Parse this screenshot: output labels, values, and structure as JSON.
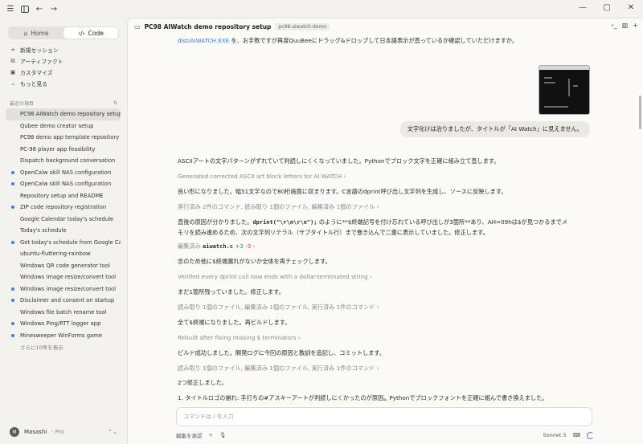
{
  "titlebar": {
    "menu_icon": "hamburger-icon",
    "sidebar_icon": "sidebar-toggle-icon",
    "back_icon": "arrow-left-icon",
    "forward_icon": "arrow-right-icon"
  },
  "sidebar": {
    "tabs": [
      {
        "label": "Home",
        "icon": "home-icon",
        "active": false
      },
      {
        "label": "Code",
        "icon": "code-icon",
        "active": true
      }
    ],
    "nav": [
      {
        "label": "新規セッション",
        "icon": "plus-icon"
      },
      {
        "label": "アーティファクト",
        "icon": "artifact-icon"
      },
      {
        "label": "カスタマイズ",
        "icon": "customize-icon"
      },
      {
        "label": "もっと見る",
        "icon": "chevron-down-icon"
      }
    ],
    "recent_heading": "最近の項目",
    "recent": [
      {
        "label": "PC98 AIWatch demo repository setup",
        "active": true,
        "dot": false
      },
      {
        "label": "Qubee demo creator setup",
        "active": false,
        "dot": false
      },
      {
        "label": "PC98 demo app template repository",
        "active": false,
        "dot": false
      },
      {
        "label": "PC-98 player app feasibility",
        "active": false,
        "dot": false
      },
      {
        "label": "Dispatch background conversation",
        "active": false,
        "dot": false
      },
      {
        "label": "OpenCalw skill NAS configuration",
        "active": false,
        "dot": true
      },
      {
        "label": "OpenCalw skill NAS configuration",
        "active": false,
        "dot": true
      },
      {
        "label": "Repository setup and README",
        "active": false,
        "dot": false
      },
      {
        "label": "ZIP code repository registration",
        "active": false,
        "dot": true
      },
      {
        "label": "Google Calendar today's schedule",
        "active": false,
        "dot": false
      },
      {
        "label": "Today's schedule",
        "active": false,
        "dot": false
      },
      {
        "label": "Get today's schedule from Google Ca",
        "active": false,
        "dot": true
      },
      {
        "label": "ubuntu-fluttering-rainbow",
        "active": false,
        "dot": false
      },
      {
        "label": "Windows QR code generator tool",
        "active": false,
        "dot": false
      },
      {
        "label": "Windows image resize/convert tool",
        "active": false,
        "dot": false
      },
      {
        "label": "Windows image resize/convert tool",
        "active": false,
        "dot": true
      },
      {
        "label": "Disclaimer and consent on startup",
        "active": false,
        "dot": true
      },
      {
        "label": "Windows file batch rename tool",
        "active": false,
        "dot": false
      },
      {
        "label": "Windows Ping/RTT logger app",
        "active": false,
        "dot": true
      },
      {
        "label": "Minesweeper WinForms game",
        "active": false,
        "dot": true
      }
    ],
    "more_label": "さらに10件を表示",
    "user": {
      "initial": "M",
      "name": "Masashi",
      "plan": "· Pro"
    }
  },
  "main": {
    "title": "PC98 AIWatch demo repository setup",
    "branch": "pc98-aiwatch-demo",
    "top_line_link": "dist/AIWATCH.EXE",
    "top_line_text": " を、お手数ですが再度QuuBeeにドラッグ&ドロップして日本語表示が直っているか確認していただけますか。",
    "user_bubble": "文字化けは治りましたが、タイトルが「AI Watch」に見えません。",
    "messages": [
      {
        "type": "text",
        "text": "ASCIIアートの文字パターンがずれていて判読しにくくなっていました。Pythonでブロック文字を正確に組み立て直します。"
      },
      {
        "type": "tool",
        "text": "Generated corrected ASCII art block letters for AI WATCH"
      },
      {
        "type": "text",
        "text": "良い形になりました。幅51文字なので80桁画面に収まります。C言語のdprint呼び出し文字列を生成し、ソースに反映します。"
      },
      {
        "type": "tool",
        "text": "実行済み 2件のコマンド, 読み取り 1個のファイル, 編集済み 1個のファイル"
      },
      {
        "type": "text2a",
        "text": "直後の原因が分かりました。",
        "code": "dprint(\"\\r\\n\\r\\n\");",
        "rest": " のように**$終端記号を付け忘れている呼び出しが3箇所**あり、AH=09hは$が見つかるまでメ"
      },
      {
        "type": "text2b",
        "text": "モリを読み進めるため、次の文字列リテラル（サブタイトル行）まで巻き込んで二重に表示していました。修正します。"
      },
      {
        "type": "edit",
        "text": "編集済み ",
        "file": "aiwatch.c",
        "add": "+3",
        "del": "-3"
      },
      {
        "type": "text",
        "text": "念のため他に$終端漏れがないか全体を再チェックします。"
      },
      {
        "type": "tool",
        "text": "Verified every dprint call now ends with a dollar-terminated string"
      },
      {
        "type": "text",
        "text": "まだ1箇所残っていました。修正します。"
      },
      {
        "type": "tool",
        "text": "読み取り 1個のファイル, 編集済み 1個のファイル, 実行済み 1件のコマンド"
      },
      {
        "type": "text",
        "text": "全て$終端になりました。再ビルドします。"
      },
      {
        "type": "tool",
        "text": "Rebuilt after fixing missing $ terminators"
      },
      {
        "type": "text",
        "text": "ビルド成功しました。開発ログに今回の原因と教訓を追記し、コミットします。"
      },
      {
        "type": "tool",
        "text": "読み取り 1個のファイル, 編集済み 1個のファイル, 実行済み 1件のコマンド"
      },
      {
        "type": "text",
        "text": "2つ修正しました。"
      },
      {
        "type": "text",
        "text": "1. タイトルロゴの崩れ: 手打ちの#アスキーアートが判読しにくかったのが原因。Pythonでブロックフォントを正確に組んで書き換えました。"
      }
    ],
    "composer_placeholder": "コマンドは / を入力",
    "footer": {
      "mode": "編集を承認",
      "model": "Sonnet 5"
    }
  }
}
